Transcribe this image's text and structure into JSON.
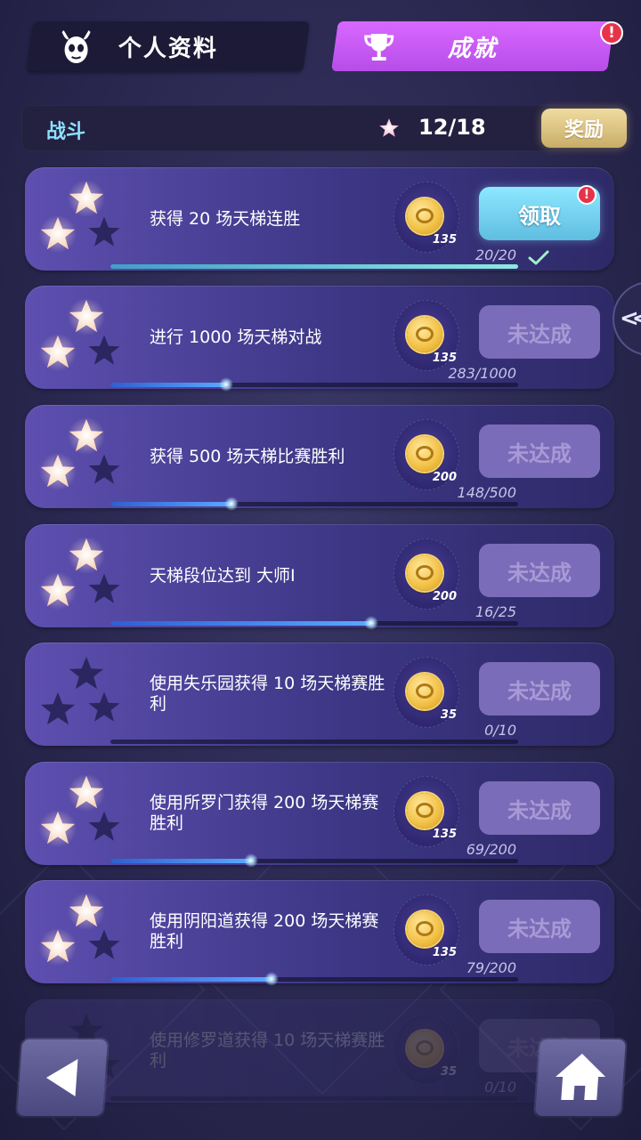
{
  "tabs": [
    {
      "label": "个人资料",
      "active": false
    },
    {
      "label": "成就",
      "active": true,
      "badge": "!"
    }
  ],
  "category": {
    "title": "战斗",
    "stars_earned": "12/18",
    "reward_label": "奖励"
  },
  "achievements": [
    {
      "text": "获得 20 场天梯连胜",
      "coins": "135",
      "progress": "20/20",
      "fill": 1.0,
      "stars_lit": 2,
      "action": "领取",
      "state": "claim",
      "badge": "!"
    },
    {
      "text": "进行 1000 场天梯对战",
      "coins": "135",
      "progress": "283/1000",
      "fill": 0.283,
      "stars_lit": 2,
      "action": "未达成",
      "state": "locked"
    },
    {
      "text": "获得 500 场天梯比赛胜利",
      "coins": "200",
      "progress": "148/500",
      "fill": 0.296,
      "stars_lit": 2,
      "action": "未达成",
      "state": "locked"
    },
    {
      "text": "天梯段位达到 大师I",
      "coins": "200",
      "progress": "16/25",
      "fill": 0.64,
      "stars_lit": 2,
      "action": "未达成",
      "state": "locked"
    },
    {
      "text": "使用失乐园获得 10 场天梯赛胜利",
      "coins": "35",
      "progress": "0/10",
      "fill": 0.0,
      "stars_lit": 0,
      "action": "未达成",
      "state": "locked"
    },
    {
      "text": "使用所罗门获得 200 场天梯赛胜利",
      "coins": "135",
      "progress": "69/200",
      "fill": 0.345,
      "stars_lit": 2,
      "action": "未达成",
      "state": "locked"
    },
    {
      "text": "使用阴阳道获得 200 场天梯赛胜利",
      "coins": "135",
      "progress": "79/200",
      "fill": 0.395,
      "stars_lit": 2,
      "action": "未达成",
      "state": "locked"
    },
    {
      "text": "使用修罗道获得 10 场天梯赛胜利",
      "coins": "35",
      "progress": "0/10",
      "fill": 0.0,
      "stars_lit": 0,
      "action": "未达成",
      "state": "locked"
    }
  ],
  "side_handle_label": "<<",
  "nav": {
    "back_icon": "back-arrow-icon",
    "home_icon": "home-icon"
  },
  "colors": {
    "accent_tab": "#c85cf0",
    "claim_button": "#7fd6f0",
    "reward_button": "#dcc27e",
    "alert": "#e6334a"
  }
}
